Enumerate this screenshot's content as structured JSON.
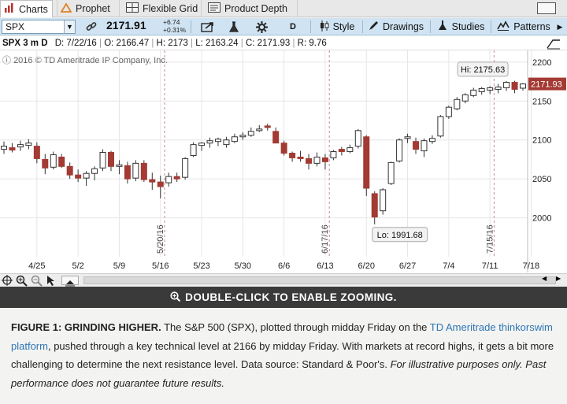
{
  "tabs": [
    {
      "label": "Charts",
      "icon": "bar-chart-icon",
      "active": true
    },
    {
      "label": "Prophet",
      "icon": "warning-triangle-icon",
      "active": false
    },
    {
      "label": "Flexible Grid",
      "icon": "grid-icon",
      "active": false
    },
    {
      "label": "Product Depth",
      "icon": "depth-icon",
      "active": false
    }
  ],
  "toolbar": {
    "symbol": "SPX",
    "last": "2171.91",
    "change": "+6.74",
    "change_pct": "+0.31%",
    "aggregation": "D",
    "style_label": "Style",
    "drawings_label": "Drawings",
    "studies_label": "Studies",
    "patterns_label": "Patterns"
  },
  "infobar": {
    "title": "SPX 3 m D",
    "date": "D: 7/22/16",
    "open": "O: 2166.47",
    "high": "H: 2173",
    "low": "L: 2163.24",
    "close": "C: 2171.93",
    "range": "R: 9.76"
  },
  "copyright": "2016 © TD Ameritrade IP Company, Inc.",
  "annotations": {
    "hi": "Hi: 2175.63",
    "lo": "Lo: 1991.68",
    "last_tag": "2171.93"
  },
  "vlines": [
    "5/20/16",
    "6/17/16",
    "7/15/16"
  ],
  "colors": {
    "up": "#ffffff",
    "down": "#a33a33",
    "toolbar": "#cfe3f2",
    "grid": "#e6e6e6",
    "accent": "#2e76b6"
  },
  "chart_data": {
    "type": "candlestick",
    "title": "",
    "xlabel": "",
    "ylabel": "",
    "ylim": [
      1950,
      2215
    ],
    "yticks": [
      2000,
      2050,
      2100,
      2150,
      2200
    ],
    "xticks": [
      "4/25",
      "5/2",
      "5/9",
      "5/16",
      "5/23",
      "5/30",
      "6/6",
      "6/13",
      "6/20",
      "6/27",
      "7/4",
      "7/11",
      "7/18"
    ],
    "candles": [
      {
        "o": 2088,
        "h": 2098,
        "l": 2082,
        "c": 2092
      },
      {
        "o": 2090,
        "h": 2096,
        "l": 2084,
        "c": 2087
      },
      {
        "o": 2091,
        "h": 2099,
        "l": 2086,
        "c": 2094
      },
      {
        "o": 2093,
        "h": 2101,
        "l": 2088,
        "c": 2096
      },
      {
        "o": 2092,
        "h": 2097,
        "l": 2070,
        "c": 2076
      },
      {
        "o": 2075,
        "h": 2082,
        "l": 2056,
        "c": 2064
      },
      {
        "o": 2065,
        "h": 2085,
        "l": 2062,
        "c": 2081
      },
      {
        "o": 2078,
        "h": 2082,
        "l": 2064,
        "c": 2066
      },
      {
        "o": 2066,
        "h": 2071,
        "l": 2050,
        "c": 2055
      },
      {
        "o": 2055,
        "h": 2062,
        "l": 2046,
        "c": 2051
      },
      {
        "o": 2051,
        "h": 2060,
        "l": 2041,
        "c": 2057
      },
      {
        "o": 2057,
        "h": 2066,
        "l": 2048,
        "c": 2063
      },
      {
        "o": 2064,
        "h": 2088,
        "l": 2060,
        "c": 2084
      },
      {
        "o": 2084,
        "h": 2086,
        "l": 2060,
        "c": 2066
      },
      {
        "o": 2066,
        "h": 2074,
        "l": 2056,
        "c": 2068
      },
      {
        "o": 2067,
        "h": 2072,
        "l": 2044,
        "c": 2050
      },
      {
        "o": 2051,
        "h": 2074,
        "l": 2047,
        "c": 2070
      },
      {
        "o": 2070,
        "h": 2074,
        "l": 2046,
        "c": 2049
      },
      {
        "o": 2049,
        "h": 2058,
        "l": 2036,
        "c": 2046
      },
      {
        "o": 2046,
        "h": 2054,
        "l": 2025,
        "c": 2040
      },
      {
        "o": 2045,
        "h": 2058,
        "l": 2040,
        "c": 2053
      },
      {
        "o": 2053,
        "h": 2058,
        "l": 2046,
        "c": 2050
      },
      {
        "o": 2052,
        "h": 2078,
        "l": 2049,
        "c": 2076
      },
      {
        "o": 2080,
        "h": 2097,
        "l": 2078,
        "c": 2094
      },
      {
        "o": 2093,
        "h": 2097,
        "l": 2086,
        "c": 2096
      },
      {
        "o": 2096,
        "h": 2103,
        "l": 2090,
        "c": 2099
      },
      {
        "o": 2098,
        "h": 2103,
        "l": 2092,
        "c": 2101
      },
      {
        "o": 2094,
        "h": 2104,
        "l": 2090,
        "c": 2100
      },
      {
        "o": 2098,
        "h": 2108,
        "l": 2096,
        "c": 2104
      },
      {
        "o": 2104,
        "h": 2110,
        "l": 2100,
        "c": 2106
      },
      {
        "o": 2106,
        "h": 2116,
        "l": 2104,
        "c": 2111
      },
      {
        "o": 2112,
        "h": 2119,
        "l": 2110,
        "c": 2114
      },
      {
        "o": 2118,
        "h": 2121,
        "l": 2112,
        "c": 2116
      },
      {
        "o": 2111,
        "h": 2116,
        "l": 2096,
        "c": 2096
      },
      {
        "o": 2096,
        "h": 2099,
        "l": 2080,
        "c": 2083
      },
      {
        "o": 2083,
        "h": 2085,
        "l": 2072,
        "c": 2077
      },
      {
        "o": 2078,
        "h": 2086,
        "l": 2072,
        "c": 2076
      },
      {
        "o": 2076,
        "h": 2082,
        "l": 2062,
        "c": 2070
      },
      {
        "o": 2070,
        "h": 2084,
        "l": 2066,
        "c": 2078
      },
      {
        "o": 2077,
        "h": 2082,
        "l": 2062,
        "c": 2072
      },
      {
        "o": 2077,
        "h": 2087,
        "l": 2074,
        "c": 2085
      },
      {
        "o": 2088,
        "h": 2091,
        "l": 2080,
        "c": 2085
      },
      {
        "o": 2085,
        "h": 2094,
        "l": 2083,
        "c": 2090
      },
      {
        "o": 2092,
        "h": 2114,
        "l": 2089,
        "c": 2112
      },
      {
        "o": 2104,
        "h": 2106,
        "l": 2028,
        "c": 2038
      },
      {
        "o": 2031,
        "h": 2034,
        "l": 1991.68,
        "c": 2001
      },
      {
        "o": 2009,
        "h": 2038,
        "l": 2004,
        "c": 2036
      },
      {
        "o": 2044,
        "h": 2072,
        "l": 2042,
        "c": 2071
      },
      {
        "o": 2073,
        "h": 2102,
        "l": 2071,
        "c": 2100
      },
      {
        "o": 2102,
        "h": 2108,
        "l": 2096,
        "c": 2104
      },
      {
        "o": 2098,
        "h": 2103,
        "l": 2082,
        "c": 2088
      },
      {
        "o": 2086,
        "h": 2102,
        "l": 2078,
        "c": 2099
      },
      {
        "o": 2098,
        "h": 2106,
        "l": 2095,
        "c": 2102
      },
      {
        "o": 2105,
        "h": 2132,
        "l": 2103,
        "c": 2130
      },
      {
        "o": 2130,
        "h": 2144,
        "l": 2127,
        "c": 2142
      },
      {
        "o": 2140,
        "h": 2155,
        "l": 2138,
        "c": 2152
      },
      {
        "o": 2150,
        "h": 2160,
        "l": 2147,
        "c": 2158
      },
      {
        "o": 2157,
        "h": 2167,
        "l": 2155,
        "c": 2164
      },
      {
        "o": 2162,
        "h": 2168,
        "l": 2158,
        "c": 2166
      },
      {
        "o": 2164,
        "h": 2169,
        "l": 2159,
        "c": 2167
      },
      {
        "o": 2165,
        "h": 2172,
        "l": 2160,
        "c": 2168
      },
      {
        "o": 2167,
        "h": 2175.63,
        "l": 2163,
        "c": 2174
      },
      {
        "o": 2174,
        "h": 2176,
        "l": 2160,
        "c": 2165
      },
      {
        "o": 2166.47,
        "h": 2173,
        "l": 2163.24,
        "c": 2171.93
      }
    ]
  },
  "zoom_hint": "DOUBLE-CLICK TO ENABLE ZOOMING.",
  "caption": {
    "lead": "FIGURE 1: GRINDING HIGHER.",
    "part1": " The S&P 500 (SPX), plotted through midday Friday on the ",
    "link": "TD Ameritrade thinkorswim platform",
    "part2": ",  pushed through a key technical level at 2166 by midday Friday. With markets at record highs, it gets a bit more challenging to determine the next resistance level. Data source: Standard & Poor's. ",
    "disclaimer": "For illustrative purposes only. Past performance does not guarantee future results."
  }
}
